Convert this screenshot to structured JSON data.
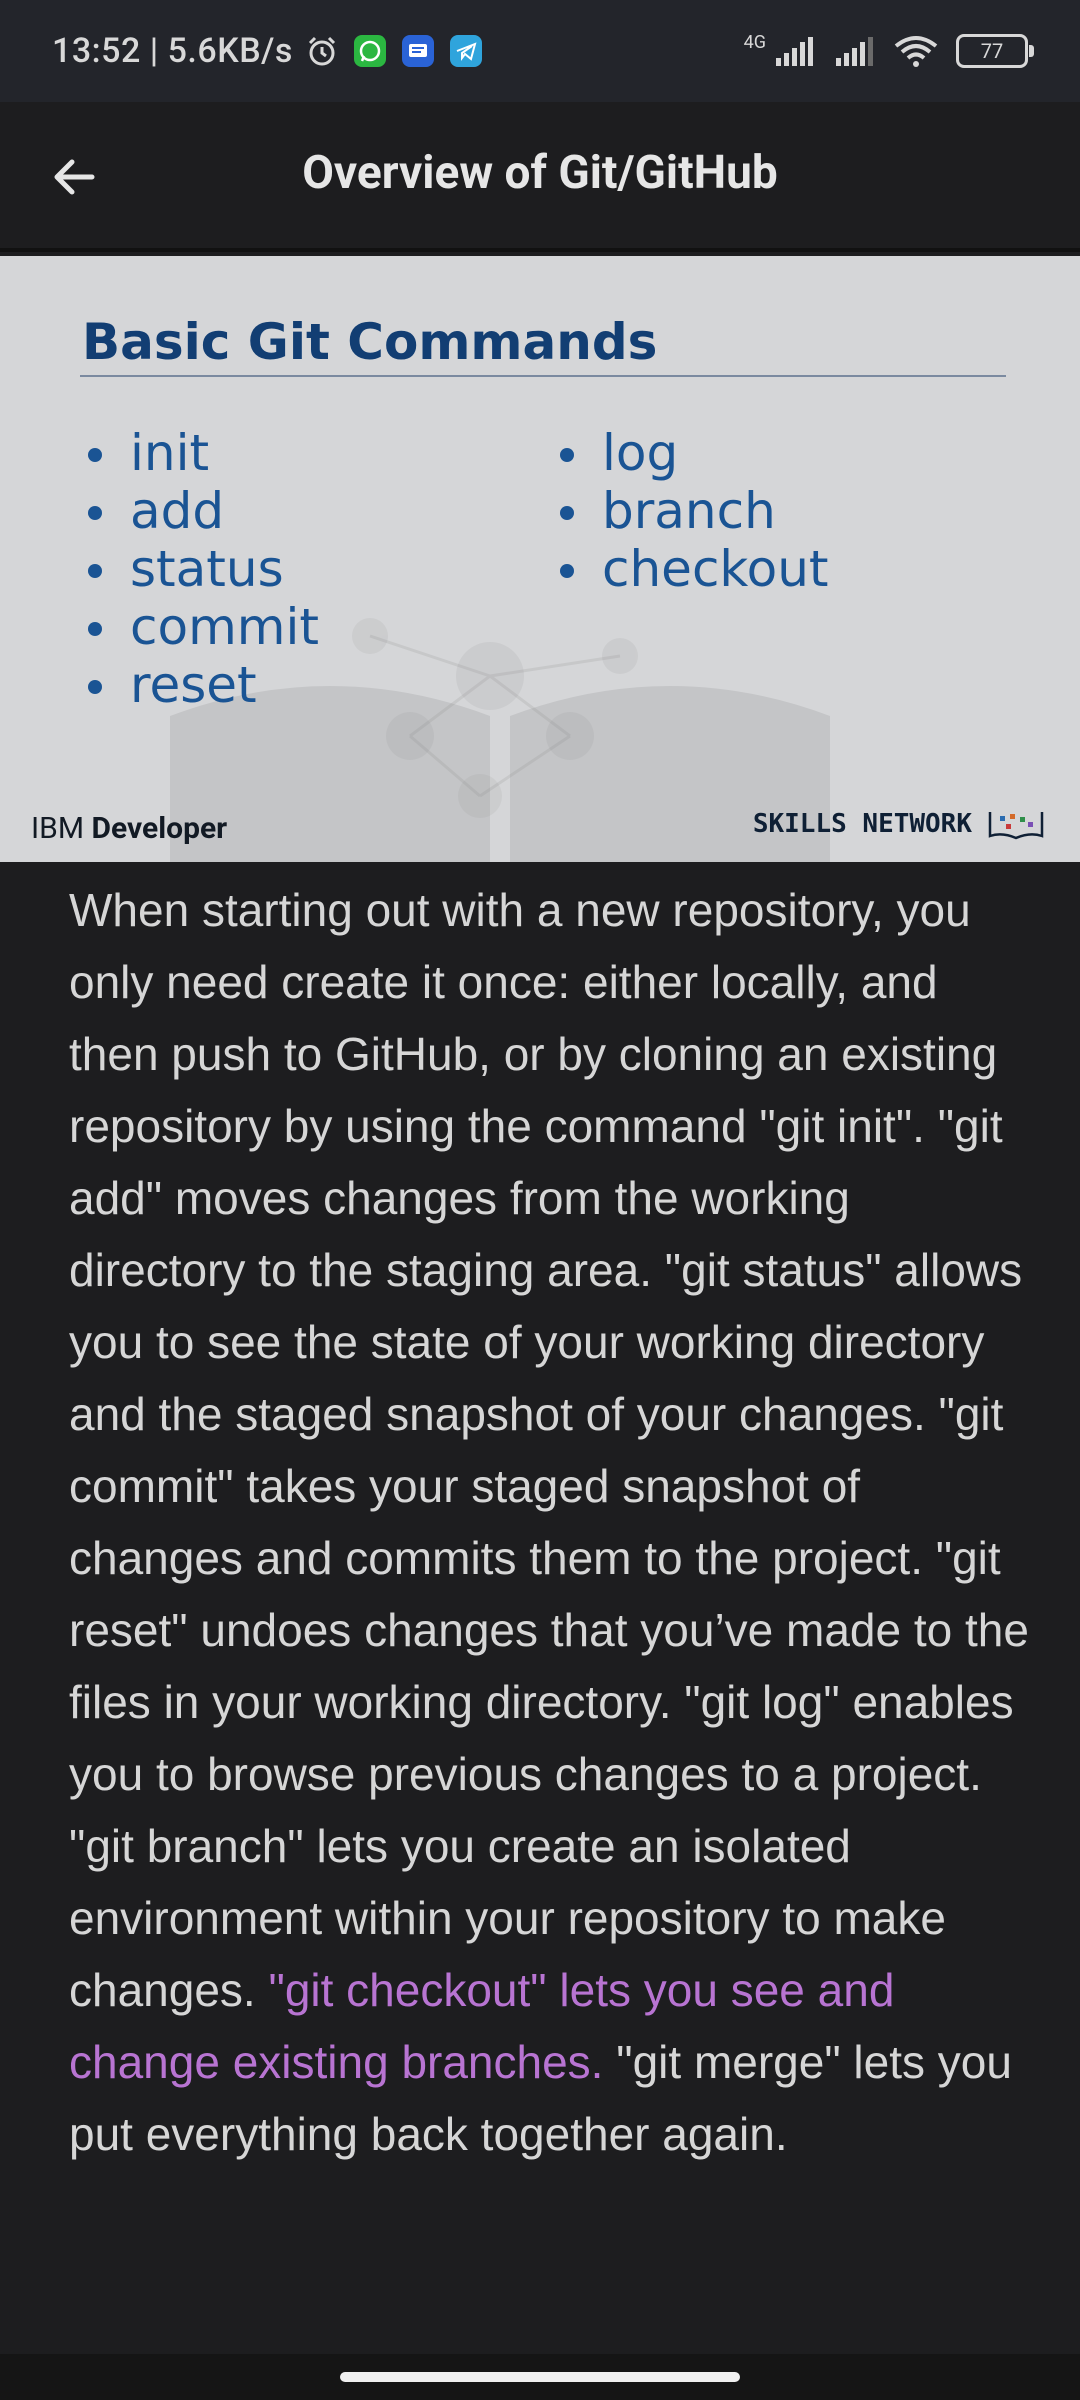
{
  "status_bar": {
    "time_speed": "13:52 | 5.6KB/s",
    "network": "4G",
    "battery": "77"
  },
  "app_bar": {
    "title": "Overview of Git/GitHub"
  },
  "slide": {
    "title": "Basic Git Commands",
    "column1": [
      "init",
      "add",
      "status",
      "commit",
      "reset"
    ],
    "column2": [
      "log",
      "branch",
      "checkout"
    ],
    "footer_left_prefix": "IBM",
    "footer_left_bold": "Developer",
    "footer_right": "SKILLS NETWORK"
  },
  "body": {
    "text_main": "When starting out with a new repository, you only need create it once: either locally, and then push to GitHub, or by cloning an existing repository by using the command \"git init\". \"git add\" moves changes from the working directory to the staging area. \"git status\" allows you to see the state of your working directory and the staged snapshot of your changes. \"git commit\" takes your staged snapshot of changes and commits them to the project. \"git reset\" undoes changes that you’ve made to the files in your working directory. \"git log\" enables you to browse previous changes to a project. \"git branch\" lets you create an isolated environment within your repository to make changes. ",
    "text_highlight": "\"git checkout\" lets you see and change existing branches.",
    "text_end": " \"git merge\" lets you put everything back together again."
  },
  "colors": {
    "background": "#1d1d1f",
    "slide_title": "#123e73",
    "slide_bullets": "#1a5494",
    "highlight": "#b874d2"
  }
}
